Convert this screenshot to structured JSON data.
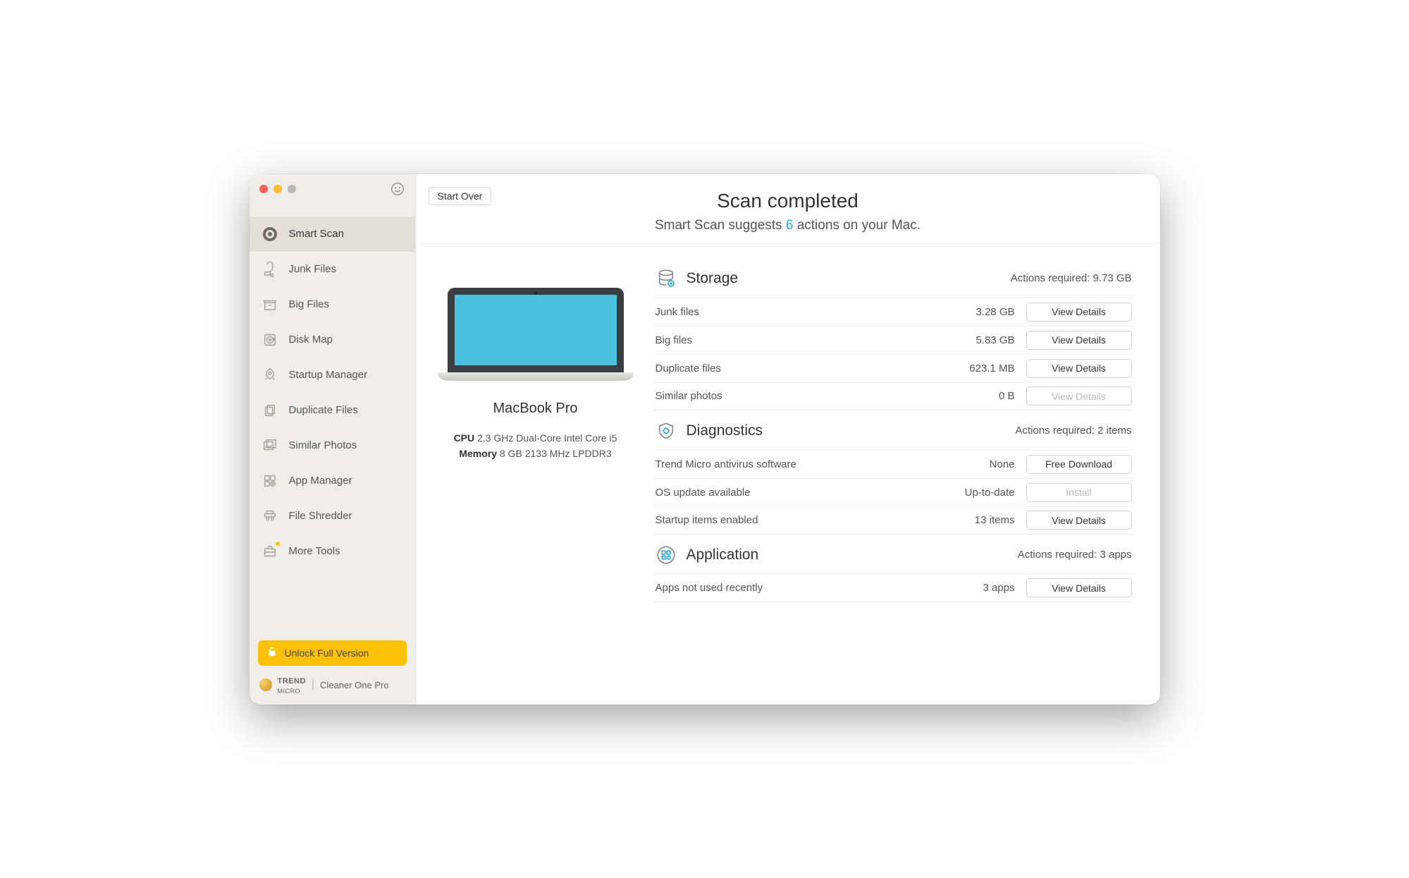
{
  "sidebar": {
    "items": [
      {
        "label": "Smart Scan",
        "icon": "target"
      },
      {
        "label": "Junk Files",
        "icon": "vacuum"
      },
      {
        "label": "Big Files",
        "icon": "box"
      },
      {
        "label": "Disk Map",
        "icon": "disk"
      },
      {
        "label": "Startup Manager",
        "icon": "rocket"
      },
      {
        "label": "Duplicate Files",
        "icon": "duplicate"
      },
      {
        "label": "Similar Photos",
        "icon": "photos"
      },
      {
        "label": "App Manager",
        "icon": "apps"
      },
      {
        "label": "File Shredder",
        "icon": "shredder"
      },
      {
        "label": "More Tools",
        "icon": "briefcase"
      }
    ],
    "unlock_label": "Unlock Full Version",
    "brand_primary": "TREND",
    "brand_secondary": "MICRO",
    "brand_product": "Cleaner One Pro"
  },
  "header": {
    "start_over": "Start Over",
    "title": "Scan completed",
    "sub_pre": "Smart Scan suggests ",
    "count": "6",
    "sub_post": " actions on your Mac."
  },
  "device": {
    "name": "MacBook Pro",
    "cpu_label": "CPU",
    "cpu_value": "2,3 GHz Dual-Core Intel Core i5",
    "mem_label": "Memory",
    "mem_value": "8 GB 2133 MHz LPDDR3"
  },
  "sections": {
    "storage": {
      "title": "Storage",
      "req": "Actions required: 9.73 GB",
      "rows": [
        {
          "label": "Junk files",
          "value": "3.28 GB",
          "action": "View Details",
          "disabled": false
        },
        {
          "label": "Big files",
          "value": "5.83 GB",
          "action": "View Details",
          "disabled": false
        },
        {
          "label": "Duplicate files",
          "value": "623.1 MB",
          "action": "View Details",
          "disabled": false
        },
        {
          "label": "Similar photos",
          "value": "0 B",
          "action": "View Details",
          "disabled": true
        }
      ]
    },
    "diagnostics": {
      "title": "Diagnostics",
      "req": "Actions required: 2 items",
      "rows": [
        {
          "label": "Trend Micro antivirus software",
          "value": "None",
          "action": "Free Download",
          "disabled": false
        },
        {
          "label": "OS update available",
          "value": "Up-to-date",
          "action": "Install",
          "disabled": true
        },
        {
          "label": "Startup items enabled",
          "value": "13 items",
          "action": "View Details",
          "disabled": false
        }
      ]
    },
    "application": {
      "title": "Application",
      "req": "Actions required: 3 apps",
      "rows": [
        {
          "label": "Apps not used recently",
          "value": "3 apps",
          "action": "View Details",
          "disabled": false
        }
      ]
    }
  }
}
